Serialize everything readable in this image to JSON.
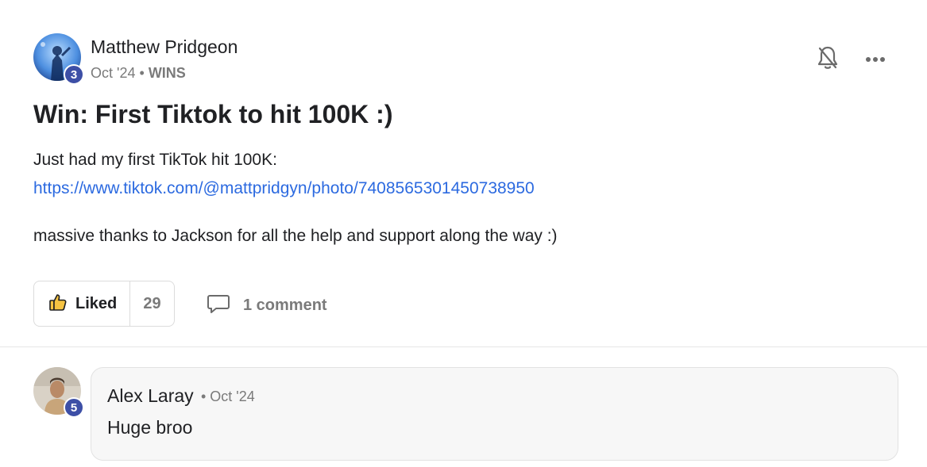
{
  "post": {
    "author": {
      "name": "Matthew Pridgeon",
      "level": "3"
    },
    "date": "Oct '24",
    "separator": "•",
    "category": "WINS",
    "title": "Win: First Tiktok to hit 100K :)",
    "body_line1": "Just had my first TikTok hit 100K:",
    "link": "https://www.tiktok.com/@mattpridgyn/photo/7408565301450738950",
    "body_line2": "massive thanks to Jackson for all the help and support along the way :)",
    "actions": {
      "like_label": "Liked",
      "like_count": "29",
      "comment_label": "1 comment"
    },
    "icons": {
      "bell": "bell-off-icon",
      "more": "more-horizontal-icon",
      "like": "thumbs-up-icon",
      "comment": "comment-icon"
    }
  },
  "comments": [
    {
      "author": {
        "name": "Alex Laray",
        "level": "5"
      },
      "date": "• Oct '24",
      "text": "Huge broo"
    }
  ],
  "colors": {
    "accent_link": "#2c6ae0",
    "level_badge": "#3d4fa6",
    "like_icon_fill": "#f5c342"
  }
}
